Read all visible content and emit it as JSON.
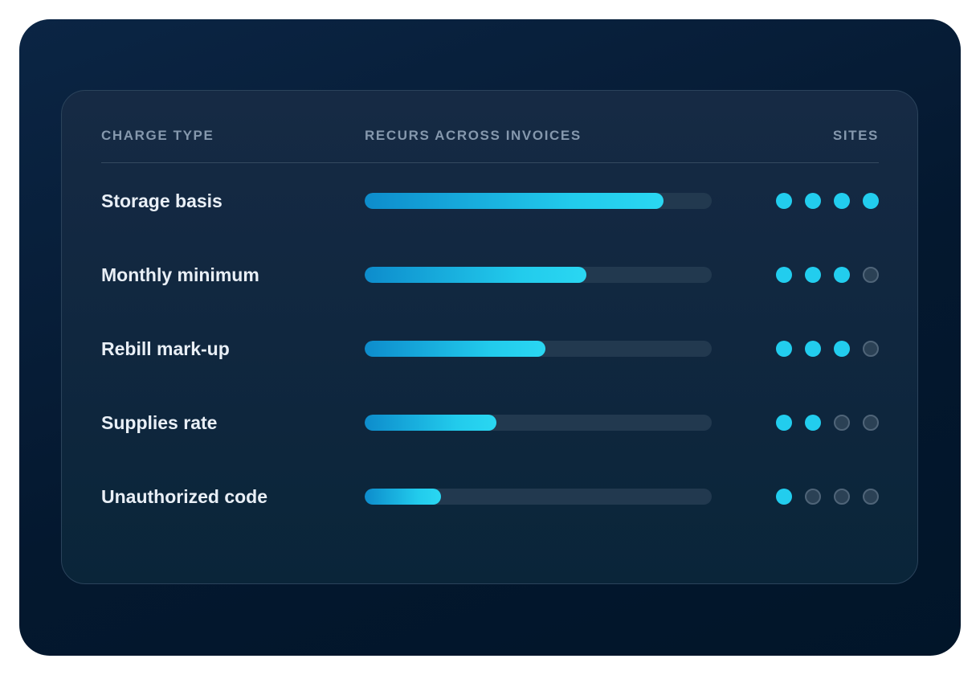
{
  "header": {
    "charge_type": "CHARGE TYPE",
    "recurs": "RECURS ACROSS INVOICES",
    "sites": "SITES"
  },
  "rows": [
    {
      "label": "Storage basis",
      "recurrence": 0.86,
      "sites_active": 4,
      "sites_total": 4
    },
    {
      "label": "Monthly minimum",
      "recurrence": 0.64,
      "sites_active": 3,
      "sites_total": 4
    },
    {
      "label": "Rebill mark-up",
      "recurrence": 0.52,
      "sites_active": 3,
      "sites_total": 4
    },
    {
      "label": "Supplies rate",
      "recurrence": 0.38,
      "sites_active": 2,
      "sites_total": 4
    },
    {
      "label": "Unauthorized code",
      "recurrence": 0.22,
      "sites_active": 1,
      "sites_total": 4
    }
  ],
  "colors": {
    "accent": "#22cdee",
    "accent_dark": "#0d8ccc",
    "track": "#22394f",
    "dot_inactive": "#2b4155"
  }
}
